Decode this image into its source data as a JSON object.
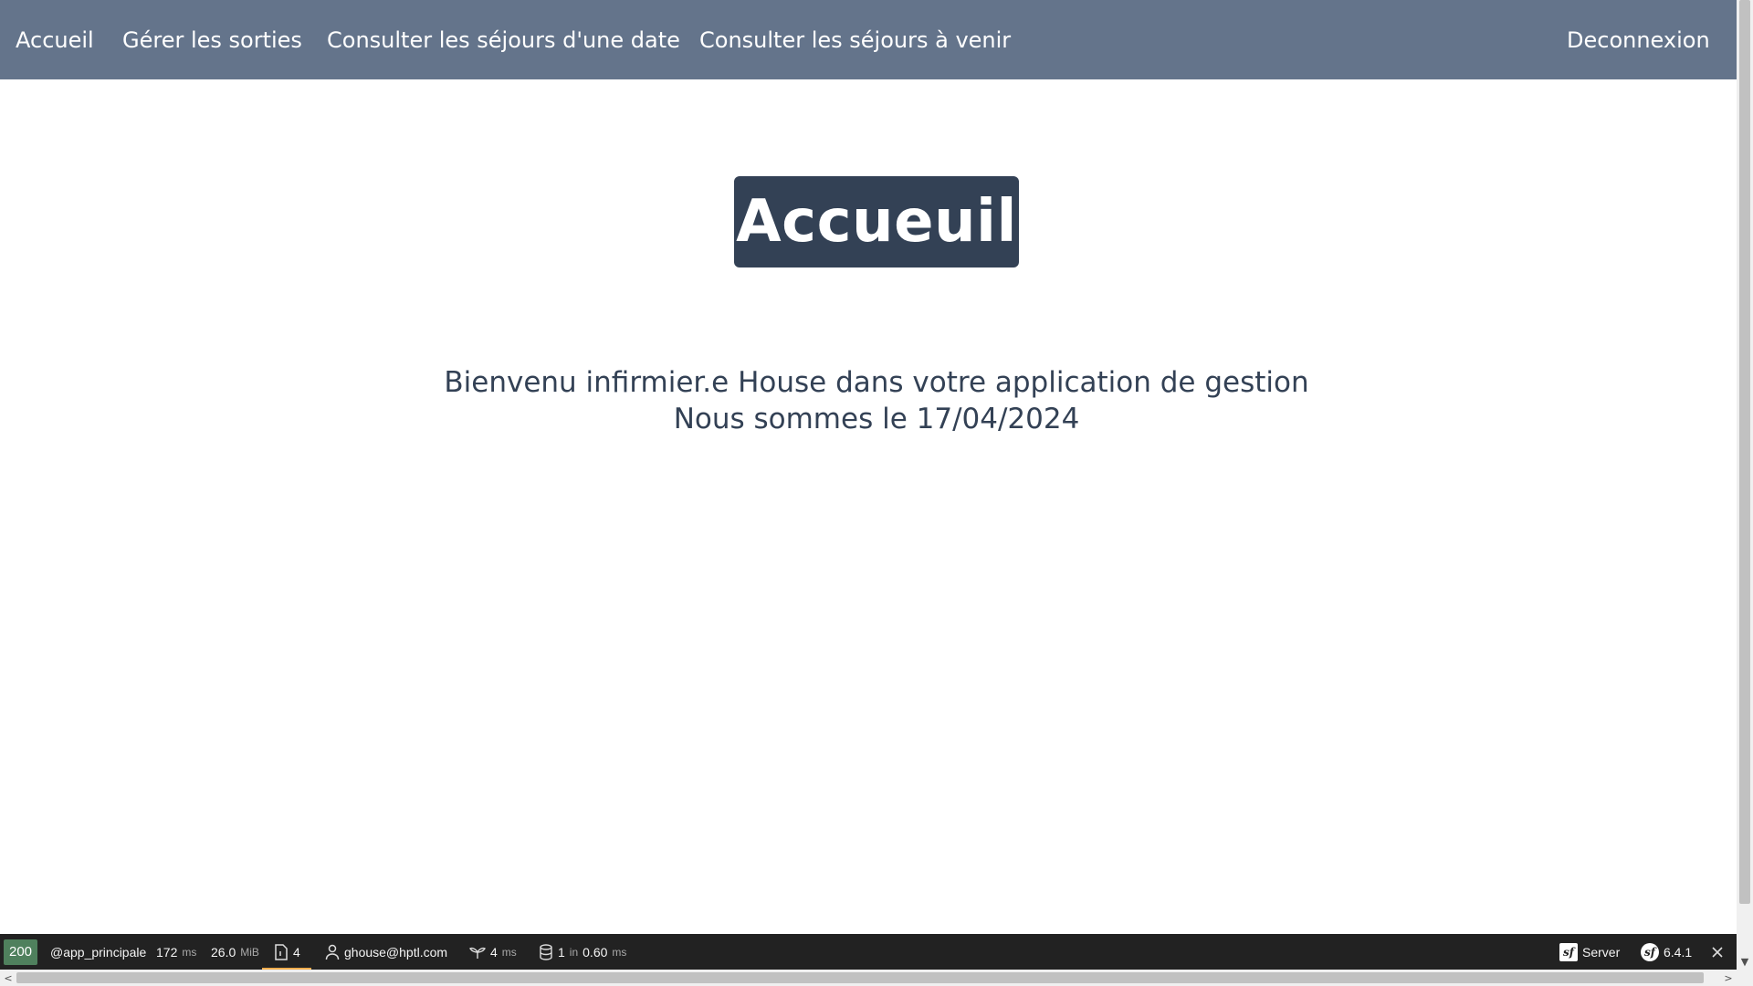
{
  "navbar": {
    "links": [
      "Accueil",
      "Gérer les sorties",
      "Consulter les séjours d'une date",
      "Consulter les séjours à venir"
    ],
    "logout": "Deconnexion"
  },
  "main": {
    "title": "Accueuil",
    "welcome_line1": "Bienvenu infirmier.e House dans votre application de gestion",
    "welcome_line2": "Nous sommes le 17/04/2024"
  },
  "debug_toolbar": {
    "status": "200",
    "route": "@app_principale",
    "time_value": "172",
    "time_unit": "ms",
    "memory_value": "26.0",
    "memory_unit": "MiB",
    "templates_count": "4",
    "user": "ghouse@hptl.com",
    "events_value": "4",
    "events_unit": "ms",
    "db_queries": "1",
    "db_in": "in",
    "db_time": "0.60",
    "db_unit": "ms",
    "server_label": "Server",
    "symfony_version": "6.4.1",
    "colors": {
      "status_ok": "#4f805d",
      "bar": "#222222",
      "active_underline": "#f0ad4e"
    }
  },
  "colors": {
    "navbar": "#64748b",
    "title_badge": "#334155",
    "text": "#334155"
  },
  "icons": [
    "template-icon",
    "user-icon",
    "events-icon",
    "database-icon",
    "symfony-server-icon",
    "symfony-logo-icon",
    "close-icon"
  ]
}
